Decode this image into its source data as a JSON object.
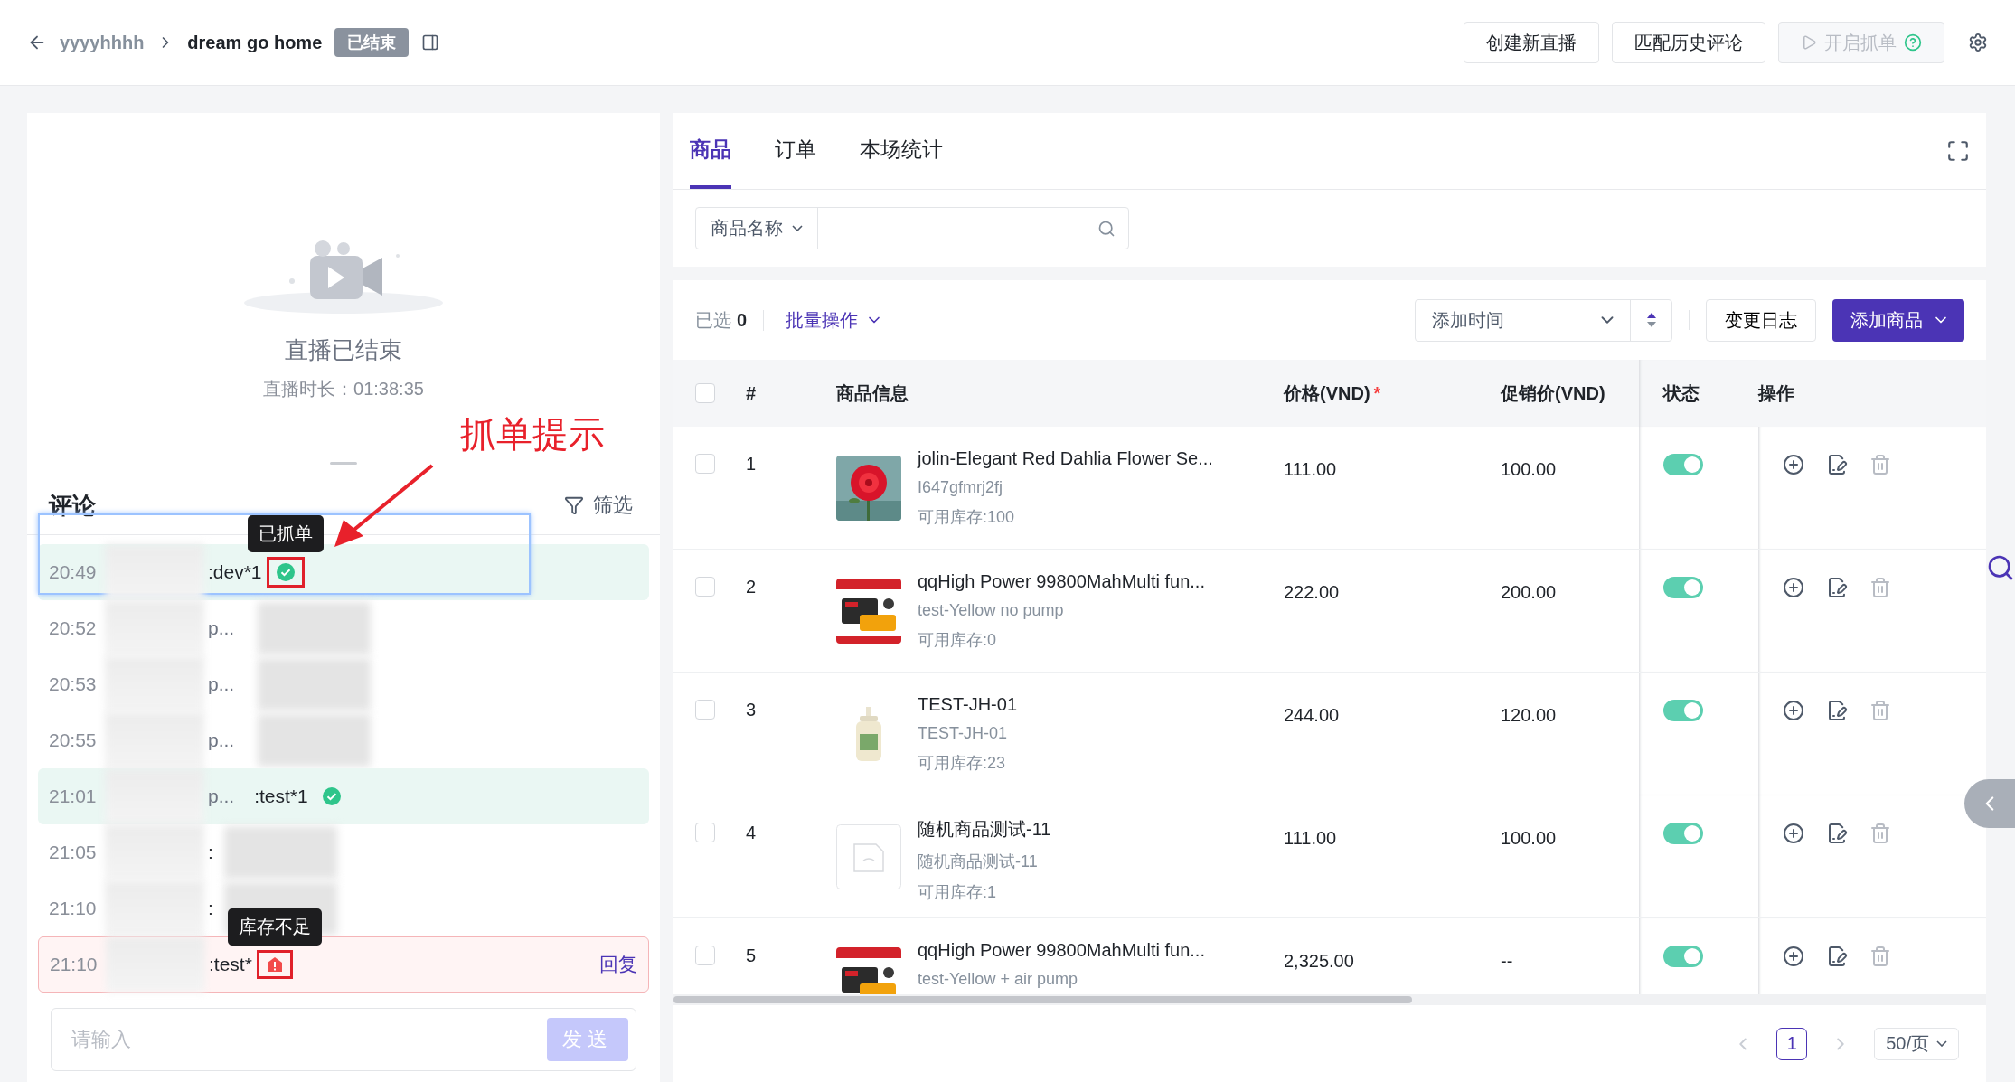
{
  "header": {
    "parent": "yyyyhhhh",
    "title": "dream go home",
    "badge": "已结束",
    "actions": [
      {
        "label": "创建新直播",
        "kind": "plain",
        "disabled": false
      },
      {
        "label": "匹配历史评论",
        "kind": "plain",
        "disabled": false
      },
      {
        "label": "开启抓单",
        "kind": "start",
        "disabled": true
      }
    ]
  },
  "live": {
    "status": "直播已结束",
    "duration": "直播时长：01:38:35"
  },
  "comments": {
    "title": "评论",
    "filter": "筛选",
    "items": [
      {
        "time": "20:49",
        "text": ":dev*1",
        "kind": "ordered",
        "tooltip": "已抓单",
        "marked": true,
        "focused": true
      },
      {
        "time": "20:52",
        "name": "p...",
        "attachment": true,
        "kind": "plain"
      },
      {
        "time": "20:53",
        "name": "p...",
        "attachment": true,
        "kind": "plain"
      },
      {
        "time": "20:55",
        "name": "p...",
        "attachment": true,
        "kind": "plain"
      },
      {
        "time": "21:01",
        "name": "p...",
        "text": ":test*1",
        "kind": "ordered"
      },
      {
        "time": "21:05",
        "text": ":",
        "attachment": true,
        "kind": "plain"
      },
      {
        "time": "21:10",
        "text": ":",
        "attachment": true,
        "kind": "plain"
      },
      {
        "time": "21:10",
        "text": ":test*",
        "kind": "out_of_stock",
        "tooltip": "库存不足",
        "marked": true,
        "reply": "回复"
      }
    ],
    "input": {
      "placeholder": "请输入"
    },
    "send": {
      "label": "发送",
      "disabled": true
    }
  },
  "annotation": {
    "label": "抓单提示"
  },
  "tabs": [
    {
      "label": "商品",
      "selected": true
    },
    {
      "label": "订单",
      "selected": false
    },
    {
      "label": "本场统计",
      "selected": false
    }
  ],
  "search": {
    "field": "商品名称"
  },
  "toolbar": {
    "selected_label": "已选",
    "selected_count": "0",
    "batch": "批量操作",
    "sort": "添加时间",
    "log": "变更日志",
    "add": "添加商品"
  },
  "table": {
    "all_checked": false,
    "columns": [
      {
        "label": "#"
      },
      {
        "label": "商品信息"
      },
      {
        "label": "价格(VND)",
        "required_mark": "*"
      },
      {
        "label": "促销价(VND)"
      },
      {
        "label": "状态"
      },
      {
        "label": "操作"
      }
    ],
    "rows": [
      {
        "checked": false,
        "index": "1",
        "name": "jolin-Elegant Red Dahlia Flower Se...",
        "sku": "I647gfmrj2fj",
        "stock": "可用库存:100",
        "price": "111.00",
        "promo": "100.00",
        "on": true
      },
      {
        "checked": false,
        "index": "2",
        "name": "qqHigh Power 99800MahMulti fun...",
        "sku": "test-Yellow no pump",
        "stock": "可用库存:0",
        "price": "222.00",
        "promo": "200.00",
        "on": true
      },
      {
        "checked": false,
        "index": "3",
        "name": "TEST-JH-01",
        "sku": "TEST-JH-01",
        "stock": "可用库存:23",
        "price": "244.00",
        "promo": "120.00",
        "on": true
      },
      {
        "checked": false,
        "index": "4",
        "kind": "no_image",
        "name": "随机商品测试-11",
        "sku": "随机商品测试-11",
        "stock": "可用库存:1",
        "price": "111.00",
        "promo": "100.00",
        "on": true
      },
      {
        "checked": false,
        "index": "5",
        "name": "qqHigh Power 99800MahMulti fun...",
        "sku": "test-Yellow + air pump",
        "price": "2,325.00",
        "promo": "--",
        "on": true
      }
    ]
  },
  "pagination": {
    "pages": [
      {
        "label": "1",
        "selected": true
      }
    ],
    "page_size": "50/页"
  }
}
